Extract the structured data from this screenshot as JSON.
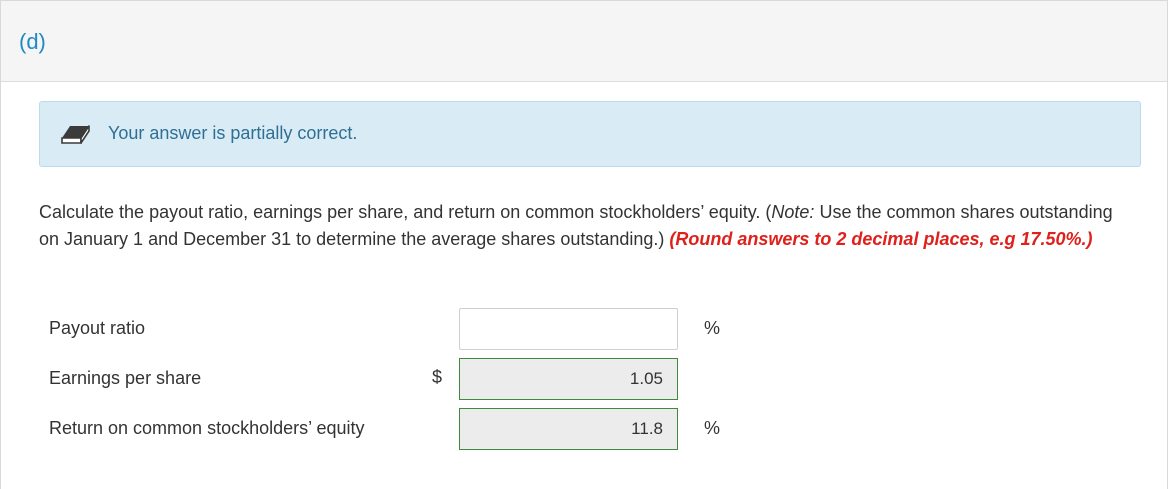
{
  "part": {
    "label": "(d)"
  },
  "feedback": {
    "icon": "eraser-icon",
    "message": "Your answer is partially correct."
  },
  "instructions": {
    "main": "Calculate the payout ratio, earnings per share, and return on common stockholders’ equity. (",
    "note_label": "Note:",
    "note_body": " Use the common shares outstanding on January 1 and December 31 to determine the average shares outstanding.) ",
    "rounding": "(Round answers to 2 decimal places, e.g 17.50%.)"
  },
  "rows": [
    {
      "label": "Payout ratio",
      "prefix": "",
      "value": "",
      "unit": "%"
    },
    {
      "label": "Earnings per share",
      "prefix": "$",
      "value": "1.05",
      "unit": ""
    },
    {
      "label": "Return on common stockholders’ equity",
      "prefix": "",
      "value": "11.8",
      "unit": "%"
    }
  ],
  "colors": {
    "part_label": "#1f8bc0",
    "feedback_bg": "#d9ecf5",
    "feedback_text": "#2f6f95",
    "rounding_note": "#e0201b",
    "filled_border": "#3f8a3f"
  }
}
